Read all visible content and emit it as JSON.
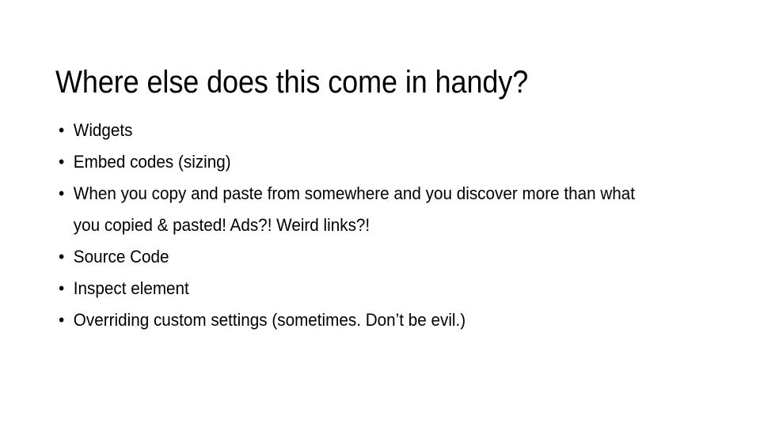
{
  "slide": {
    "title": "Where else does this come in handy?",
    "bullet_marker": "•",
    "bullets": [
      {
        "text": "Widgets"
      },
      {
        "text": "Embed codes (sizing)"
      },
      {
        "text": "When you copy and paste from somewhere and you discover more than what you copied & pasted! Ads?! Weird links?!"
      },
      {
        "text": "Source Code"
      },
      {
        "text": "Inspect element"
      },
      {
        "text": "Overriding custom settings (sometimes. Don’t be evil.)"
      }
    ],
    "colors": {
      "background": "#ffffff",
      "text": "#000000"
    }
  }
}
